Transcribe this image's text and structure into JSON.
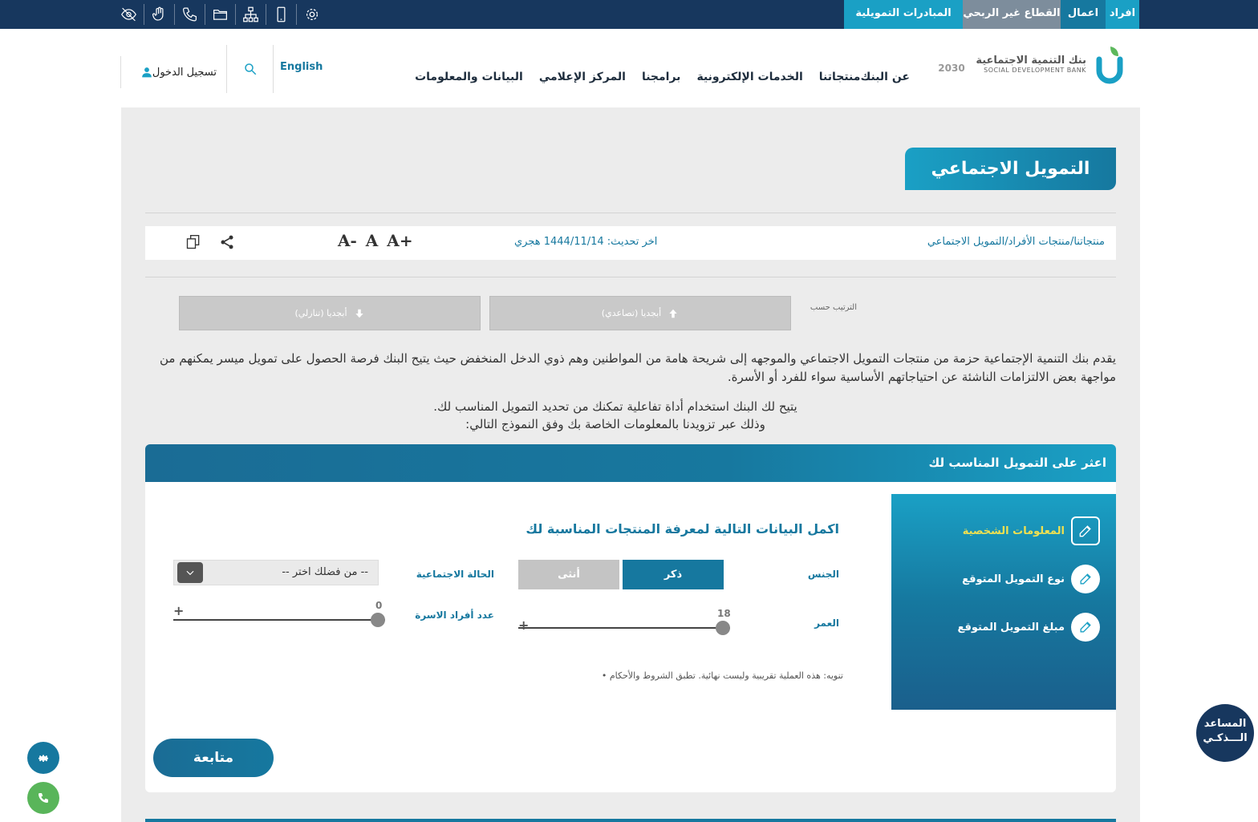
{
  "topbar": {
    "tabs": [
      "افراد",
      "اعمال",
      "القطاع غير الربحي",
      "المبادرات التمويلية"
    ],
    "icons": [
      "eye-off-icon",
      "sign-language-icon",
      "phone-icon",
      "folder-icon",
      "sitemap-icon",
      "mobile-icon",
      "settings-gear-icon"
    ]
  },
  "header": {
    "logo_ar": "بنك التنمية الاجتماعية",
    "logo_en": "SOCIAL DEVELOPMENT BANK",
    "vision": "2030",
    "nav": [
      "عن البنك",
      "منتجاتنا",
      "الخدمات الإلكترونية",
      "برامجنا",
      "المركز الإعلامي",
      "البيانات والمعلومات"
    ],
    "lang": "English",
    "login": "تسجيل الدخول"
  },
  "page": {
    "title": "التمويل الاجتماعي",
    "breadcrumb": "منتجاتنا/منتجات الأفراد/التمويل الاجتماعي",
    "updated": "اخر تحديث: 1444/11/14 هجري",
    "font_controls": [
      "A+",
      "A",
      "A-"
    ]
  },
  "sort": {
    "label": "الترتيب حسب",
    "asc": "أبجديا (تصاعدي)",
    "desc": "أبجديا (تنازلي)"
  },
  "intro": {
    "p1": "يقدم بنك التنمية الإجتماعية حزمة من منتجات التمويل الاجتماعي والموجهه إلى شريحة هامة من المواطنين وهم ذوي الدخل المنخفض حيث يتيح البنك فرصة الحصول على تمويل ميسر يمكنهم من مواجهة بعض الالتزامات الناشئة عن احتياجاتهم الأساسية سواء للفرد أو الأسرة.",
    "p2_line1": "يتيح لك البنك استخدام أداة تفاعلية تمكنك من تحديد التمويل المناسب لك.",
    "p2_line2": "وذلك عبر تزويدنا بالمعلومات الخاصة بك وفق النموذج التالي:"
  },
  "finder": {
    "header": "اعثر على التمويل المناسب لك",
    "steps": [
      {
        "label": "المعلومات الشخصية",
        "active": true
      },
      {
        "label": "نوع التمويل المتوقع",
        "active": false
      },
      {
        "label": "مبلغ التمويل المتوقع",
        "active": false
      }
    ],
    "form_title": "اكمل البيانات التالية لمعرفة المنتجات المناسبة لك",
    "gender_label": "الجنس",
    "gender_male": "ذكر",
    "gender_female": "أنثى",
    "marital_label": "الحالة الاجتماعية",
    "marital_value": "-- من فضلك اختر --",
    "age_label": "العمر",
    "age_value": "18",
    "family_label": "عدد أفراد الاسرة",
    "family_value": "0",
    "plus": "+",
    "note": "• تنويه: هذه العملية تقريبية وليست نهائية. تطبق الشروط والأحكام",
    "continue": "متابعة"
  },
  "assistant": {
    "line1": "المساعد",
    "line2": "الـــذكـي"
  },
  "colors": {
    "navy": "#17375e",
    "teal": "#16789f",
    "cyan": "#1aa0c5",
    "active_step": "#f0e050"
  }
}
